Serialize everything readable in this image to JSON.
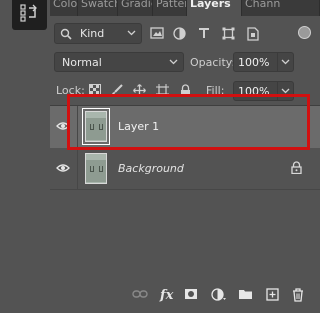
{
  "tabs": [
    {
      "label": "Color"
    },
    {
      "label": "Swatch"
    },
    {
      "label": "Gradie"
    },
    {
      "label": "Patter"
    },
    {
      "label": "Layers"
    },
    {
      "label": "Chann"
    }
  ],
  "filter": {
    "kind_label": "Kind",
    "icons": [
      "image-filter-icon",
      "adjustment-filter-icon",
      "type-filter-icon",
      "shape-filter-icon",
      "smart-object-filter-icon"
    ]
  },
  "blend": {
    "mode": "Normal",
    "opacity_label": "Opacity:",
    "opacity_value": "100%"
  },
  "lock": {
    "label": "Lock:",
    "fill_label": "Fill:",
    "fill_value": "100%"
  },
  "layers": [
    {
      "name": "Layer 1",
      "visible": true,
      "selected": true,
      "locked": false
    },
    {
      "name": "Background",
      "visible": true,
      "selected": false,
      "locked": true
    }
  ],
  "colors": {
    "panel": "#535353",
    "selected_row": "#6b6b6b",
    "highlight_box": "#d11010"
  },
  "bottom_bar": {
    "fx_label": "fx",
    "icons": [
      "link-layers-icon",
      "fx-icon",
      "layer-mask-icon",
      "adjustment-layer-icon",
      "new-group-icon",
      "new-layer-icon",
      "trash-icon"
    ]
  }
}
